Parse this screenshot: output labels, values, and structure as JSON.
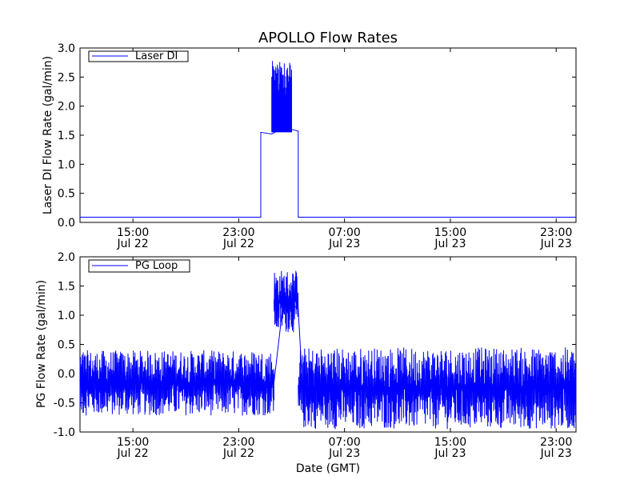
{
  "title": "APOLLO Flow Rates",
  "colors": {
    "series": "#0000ff",
    "axis": "#000000",
    "background": "#ffffff"
  },
  "chart_data": [
    {
      "type": "line",
      "title": "APOLLO Flow Rates",
      "ylabel": "Laser DI Flow Rate (gal/min)",
      "xlabel": "",
      "xlim": [
        "2014-07-22 11:00",
        "2014-07-24 00:30"
      ],
      "ylim": [
        0,
        3
      ],
      "y_ticks": [
        "0.0",
        "0.5",
        "1.0",
        "1.5",
        "2.0",
        "2.5",
        "3.0"
      ],
      "x_ticks": [
        {
          "time": "2014-07-22 15:00",
          "line1": "15:00",
          "line2": "Jul 22"
        },
        {
          "time": "2014-07-22 23:00",
          "line1": "23:00",
          "line2": "Jul 22"
        },
        {
          "time": "2014-07-23 07:00",
          "line1": "07:00",
          "line2": "Jul 23"
        },
        {
          "time": "2014-07-23 15:00",
          "line1": "15:00",
          "line2": "Jul 23"
        },
        {
          "time": "2014-07-23 23:00",
          "line1": "23:00",
          "line2": "Jul 23"
        }
      ],
      "legend": "top-left",
      "grid": false,
      "series": [
        {
          "name": "Laser DI",
          "x": [
            "2014-07-22 11:00",
            "2014-07-23 00:40",
            "2014-07-23 00:40",
            "2014-07-23 01:30",
            "2014-07-23 02:00",
            "2014-07-23 03:00",
            "2014-07-23 03:30",
            "2014-07-23 03:30",
            "2014-07-24 00:30"
          ],
          "y": [
            0.09,
            0.09,
            1.55,
            1.52,
            1.58,
            1.6,
            1.57,
            0.09,
            0.09
          ],
          "spikes": {
            "from": "2014-07-23 01:30",
            "to": "2014-07-23 03:00",
            "min": 1.55,
            "max": 2.78
          }
        }
      ]
    },
    {
      "type": "line",
      "title": "",
      "ylabel": "PG Flow Rate (gal/min)",
      "xlabel": "Date (GMT)",
      "xlim": [
        "2014-07-22 11:00",
        "2014-07-24 00:30"
      ],
      "ylim": [
        -1,
        2
      ],
      "y_ticks": [
        "-1.0",
        "-0.5",
        "0.0",
        "0.5",
        "1.0",
        "1.5",
        "2.0"
      ],
      "x_ticks": [
        {
          "time": "2014-07-22 15:00",
          "line1": "15:00",
          "line2": "Jul 22"
        },
        {
          "time": "2014-07-22 23:00",
          "line1": "23:00",
          "line2": "Jul 22"
        },
        {
          "time": "2014-07-23 07:00",
          "line1": "07:00",
          "line2": "Jul 23"
        },
        {
          "time": "2014-07-23 15:00",
          "line1": "15:00",
          "line2": "Jul 23"
        },
        {
          "time": "2014-07-23 23:00",
          "line1": "23:00",
          "line2": "Jul 23"
        }
      ],
      "legend": "top-left",
      "grid": false,
      "series": [
        {
          "name": "PG Loop",
          "x": [
            "2014-07-22 11:00",
            "2014-07-23 01:40",
            "2014-07-23 02:20",
            "2014-07-23 03:00",
            "2014-07-23 03:30",
            "2014-07-23 03:50",
            "2014-07-24 00:30"
          ],
          "y": [
            -0.15,
            -0.15,
            1.15,
            1.2,
            1.1,
            -0.25,
            -0.2
          ],
          "noise": [
            {
              "from": "2014-07-22 11:00",
              "to": "2014-07-23 01:40",
              "min": -0.72,
              "max": 0.4
            },
            {
              "from": "2014-07-23 01:40",
              "to": "2014-07-23 03:30",
              "min": 0.7,
              "max": 1.78
            },
            {
              "from": "2014-07-23 03:30",
              "to": "2014-07-24 00:30",
              "min": -0.95,
              "max": 0.45
            }
          ]
        }
      ]
    }
  ]
}
